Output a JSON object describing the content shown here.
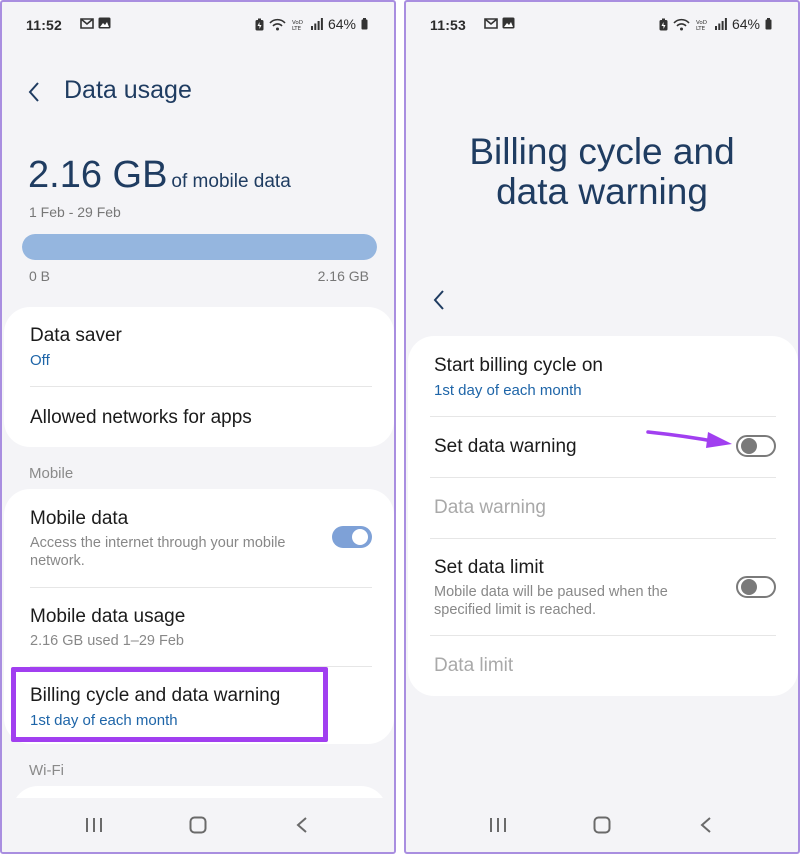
{
  "left": {
    "status": {
      "time": "11:52",
      "battery": "64%"
    },
    "header": {
      "title": "Data usage"
    },
    "usage": {
      "amount": "2.16 GB",
      "unit": "of mobile data",
      "period": "1 Feb - 29 Feb",
      "bar_fraction": 1.0,
      "bar_min": "0 B",
      "bar_max": "2.16 GB"
    },
    "card1": {
      "data_saver": {
        "title": "Data saver",
        "value": "Off"
      },
      "allowed_networks": {
        "title": "Allowed networks for apps"
      }
    },
    "section_mobile": "Mobile",
    "card2": {
      "mobile_data": {
        "title": "Mobile data",
        "description": "Access the internet through your mobile network.",
        "enabled": true
      },
      "mobile_data_usage": {
        "title": "Mobile data usage",
        "description": "2.16 GB used 1–29 Feb"
      },
      "billing": {
        "title": "Billing cycle and data warning",
        "value": "1st day of each month"
      }
    },
    "section_wifi": "Wi-Fi"
  },
  "right": {
    "status": {
      "time": "11:53",
      "battery": "64%"
    },
    "title": "Billing cycle and data warning",
    "start_billing": {
      "title": "Start billing cycle on",
      "value": "1st day of each month"
    },
    "set_data_warning": {
      "title": "Set data warning",
      "enabled": false
    },
    "data_warning": {
      "title": "Data warning"
    },
    "set_data_limit": {
      "title": "Set data limit",
      "description": "Mobile data will be paused when the specified limit is reached.",
      "enabled": false
    },
    "data_limit": {
      "title": "Data limit"
    }
  },
  "colors": {
    "accent": "#1e65a8",
    "title_text": "#1f3c61",
    "highlight": "#a13ff0",
    "arrow": "#a13ff0",
    "toggle_on": "#7ea1d7"
  },
  "icons": {
    "back": "chevron-left-icon",
    "nav_recents": "recents-icon",
    "nav_home": "home-icon",
    "nav_back": "back-icon"
  }
}
